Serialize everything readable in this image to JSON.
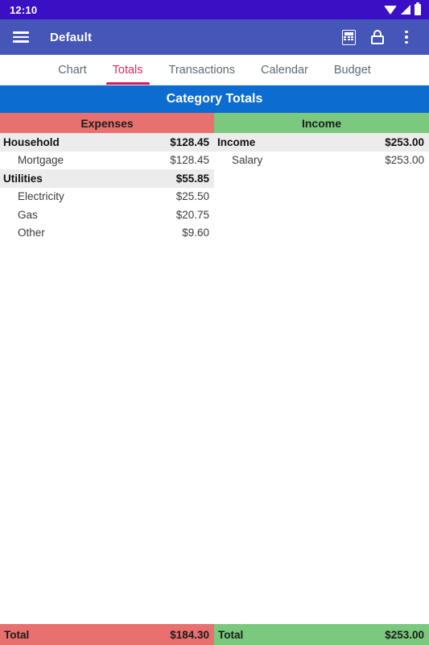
{
  "status_bar": {
    "clock": "12:10",
    "icons": [
      "wifi-icon",
      "signal-icon",
      "battery-icon"
    ],
    "background": "#3B10C4"
  },
  "app_bar": {
    "menu_icon": "hamburger-menu-icon",
    "title": "Default",
    "actions": [
      "calculator-icon",
      "lock-icon",
      "overflow-menu-icon"
    ],
    "background": "#4656B8"
  },
  "tabs": {
    "items": [
      {
        "label": "Chart",
        "active": false
      },
      {
        "label": "Totals",
        "active": true
      },
      {
        "label": "Transactions",
        "active": false
      },
      {
        "label": "Calendar",
        "active": false
      },
      {
        "label": "Budget",
        "active": false
      }
    ],
    "active_color": "#E5265C",
    "inactive_color": "#5f6a75"
  },
  "banner": {
    "title": "Category Totals",
    "background": "#0C6CD0"
  },
  "expenses": {
    "header": "Expenses",
    "header_color": "#E8706E",
    "rows": [
      {
        "label": "Household",
        "amount": "$128.45",
        "type": "parent"
      },
      {
        "label": "Mortgage",
        "amount": "$128.45",
        "type": "child"
      },
      {
        "label": "Utilities",
        "amount": "$55.85",
        "type": "parent"
      },
      {
        "label": "Electricity",
        "amount": "$25.50",
        "type": "child"
      },
      {
        "label": "Gas",
        "amount": "$20.75",
        "type": "child"
      },
      {
        "label": "Other",
        "amount": "$9.60",
        "type": "child"
      }
    ],
    "total_label": "Total",
    "total_amount": "$184.30"
  },
  "income": {
    "header": "Income",
    "header_color": "#7BC97F",
    "rows": [
      {
        "label": "Income",
        "amount": "$253.00",
        "type": "parent"
      },
      {
        "label": "Salary",
        "amount": "$253.00",
        "type": "child"
      }
    ],
    "total_label": "Total",
    "total_amount": "$253.00"
  }
}
